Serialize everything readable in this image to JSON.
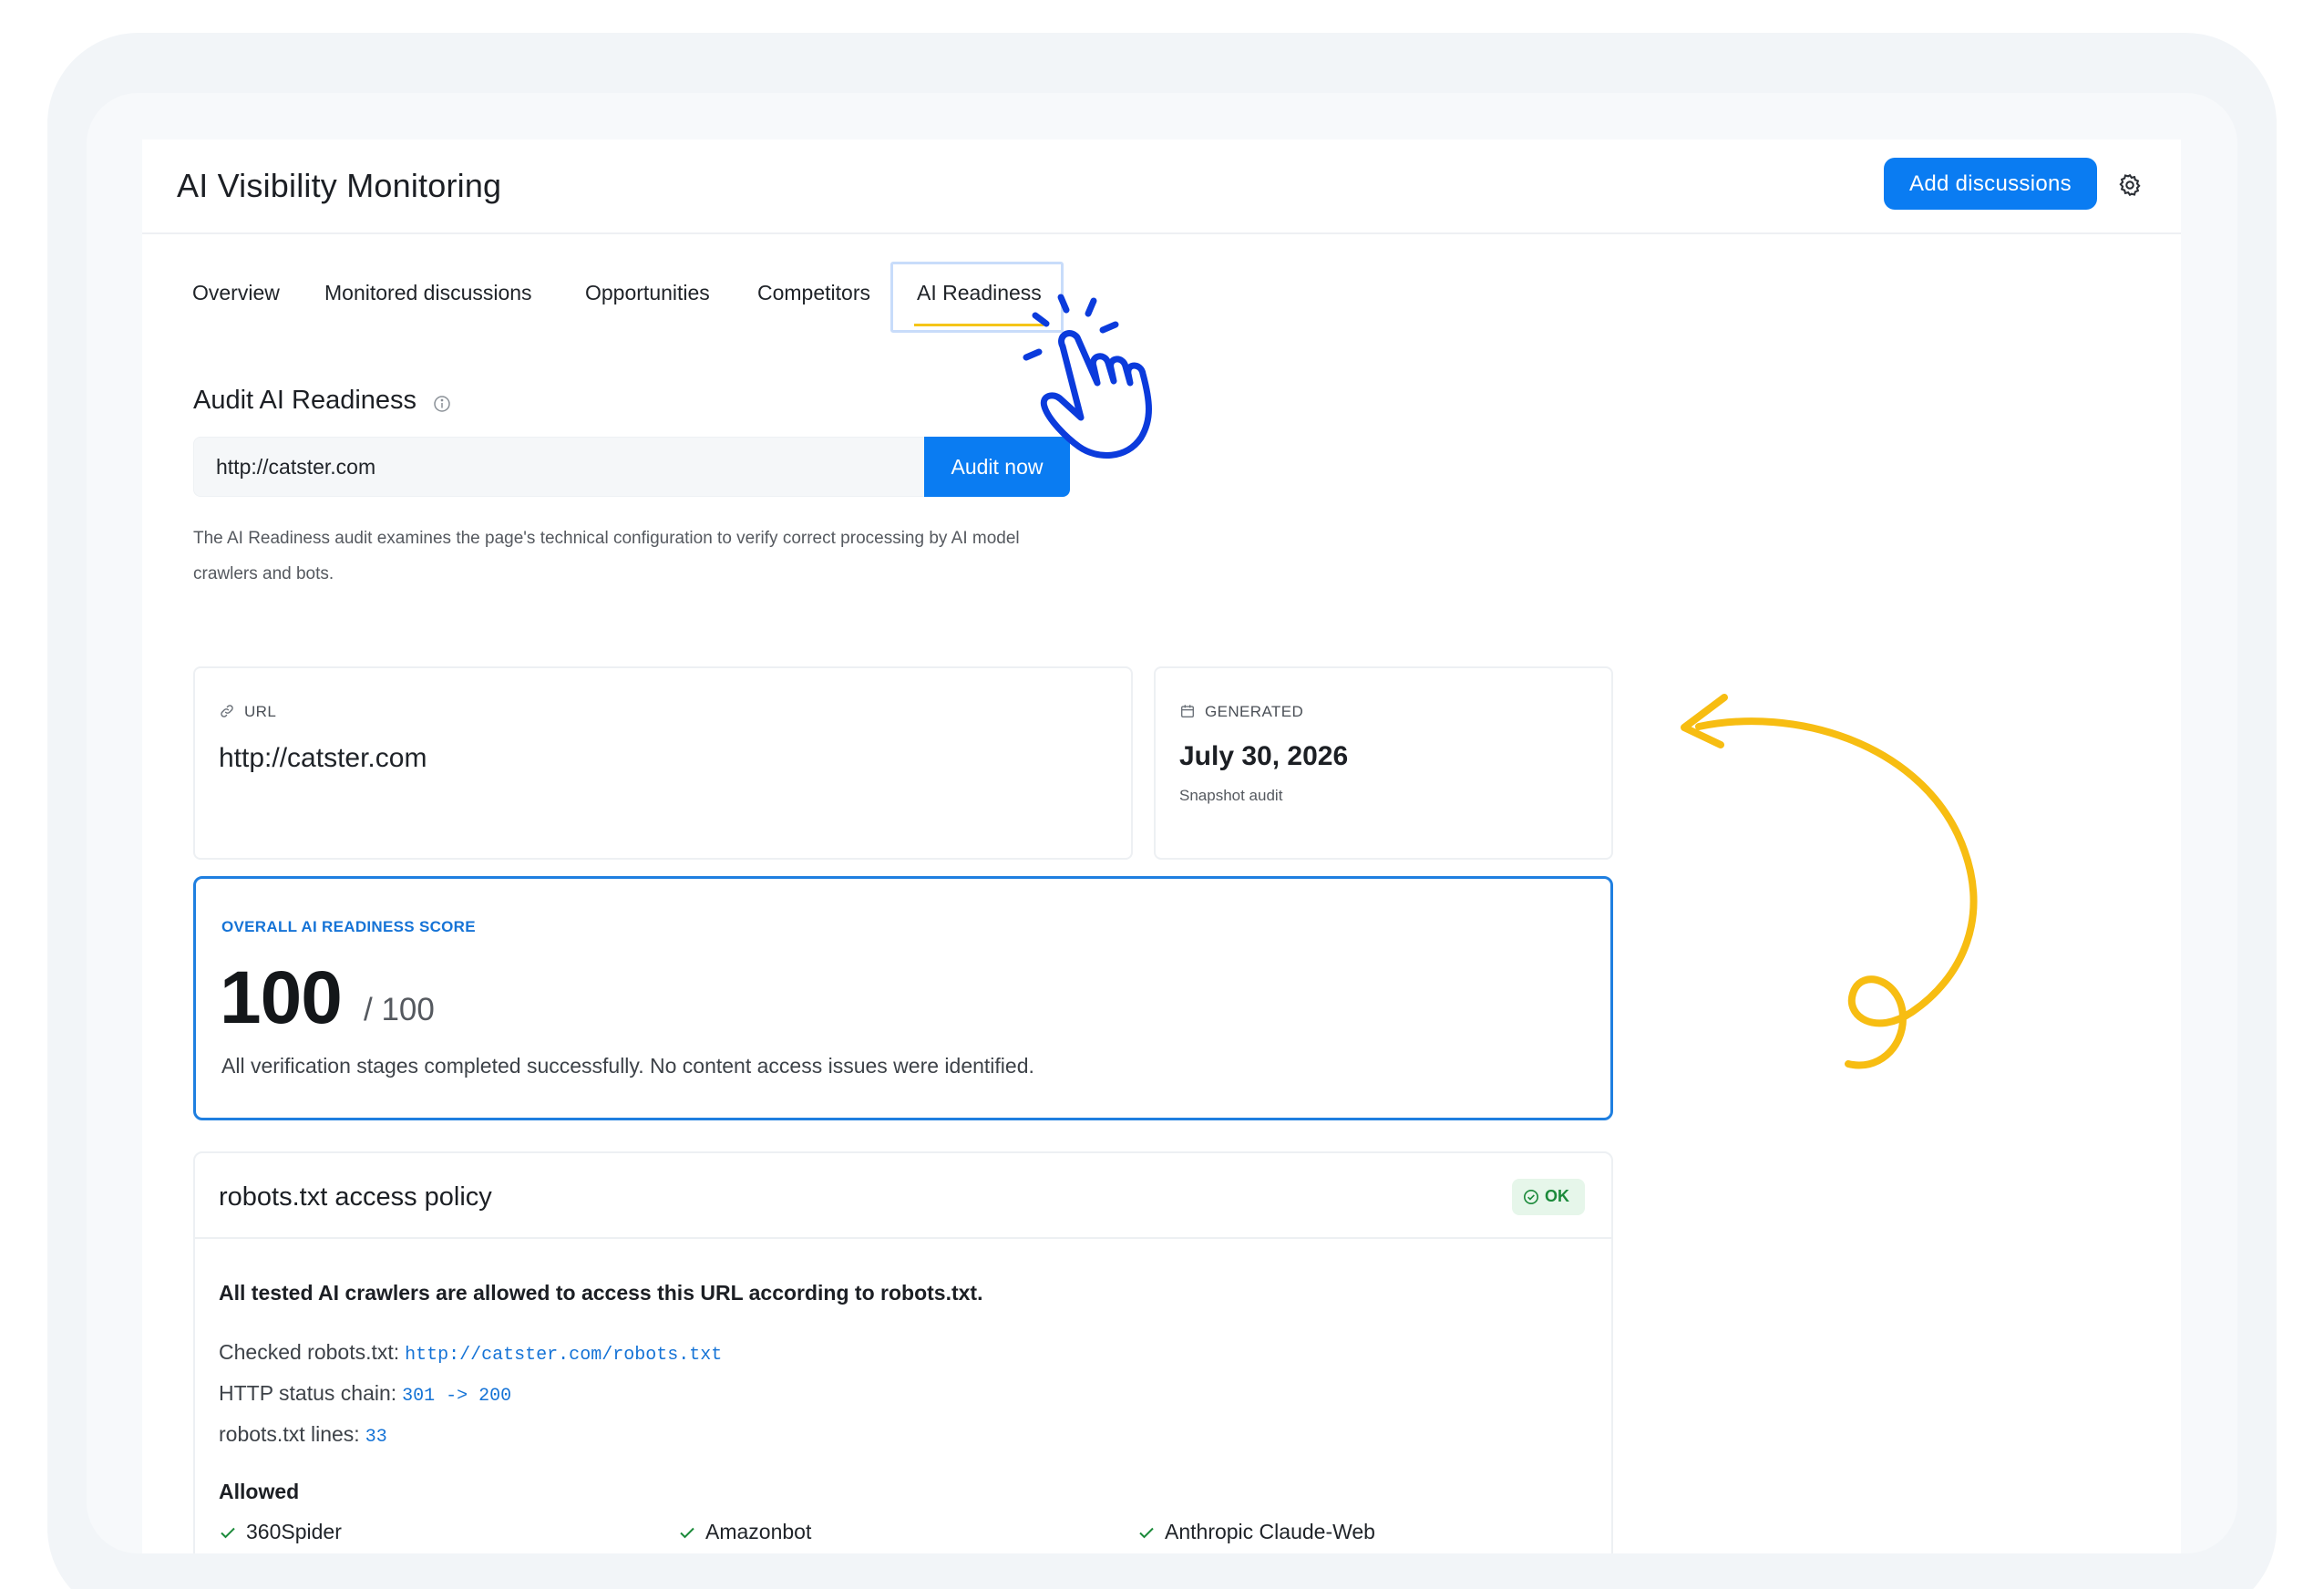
{
  "app": {
    "title": "AI Visibility Monitoring"
  },
  "header": {
    "add_button": "Add discussions",
    "settings_icon": "gear-icon"
  },
  "tabs": [
    {
      "label": "Overview"
    },
    {
      "label": "Monitored discussions"
    },
    {
      "label": "Opportunities"
    },
    {
      "label": "Competitors"
    },
    {
      "label": "AI Readiness",
      "active": true
    }
  ],
  "audit": {
    "title": "Audit AI Readiness",
    "input_value": "http://catster.com",
    "button": "Audit now",
    "description": "The AI Readiness audit examines the page's technical configuration to verify correct processing by AI model crawlers and bots."
  },
  "url_card": {
    "label": "URL",
    "value": "http://catster.com",
    "icon": "link-icon"
  },
  "generated_card": {
    "label": "GENERATED",
    "value": "July 30, 2026",
    "sub": "Snapshot audit",
    "icon": "calendar-icon"
  },
  "score": {
    "label": "OVERALL AI READINESS SCORE",
    "value": "100",
    "max": "/ 100",
    "description": "All verification stages completed successfully. No content access issues were identified."
  },
  "robots": {
    "title": "robots.txt access policy",
    "status": "OK",
    "summary": "All tested AI crawlers are allowed to access this URL according to robots.txt.",
    "checked_label": "Checked robots.txt:",
    "checked_value": "http://catster.com/robots.txt",
    "status_chain_label": "HTTP status chain:",
    "status_chain_value": "301 -> 200",
    "lines_label": "robots.txt lines:",
    "lines_value": "33",
    "allowed_title": "Allowed",
    "allowed": [
      "360Spider",
      "Amazonbot",
      "Anthropic Claude-Web"
    ]
  },
  "colors": {
    "primary": "#0a7cf2",
    "score_border": "#1f7fe0",
    "ok_bg": "#e6f6ea",
    "ok_text": "#1b8a3a",
    "annotation_blue": "#0b3bdc",
    "annotation_yellow": "#f7bd12",
    "tab_underline": "#f5c518"
  }
}
